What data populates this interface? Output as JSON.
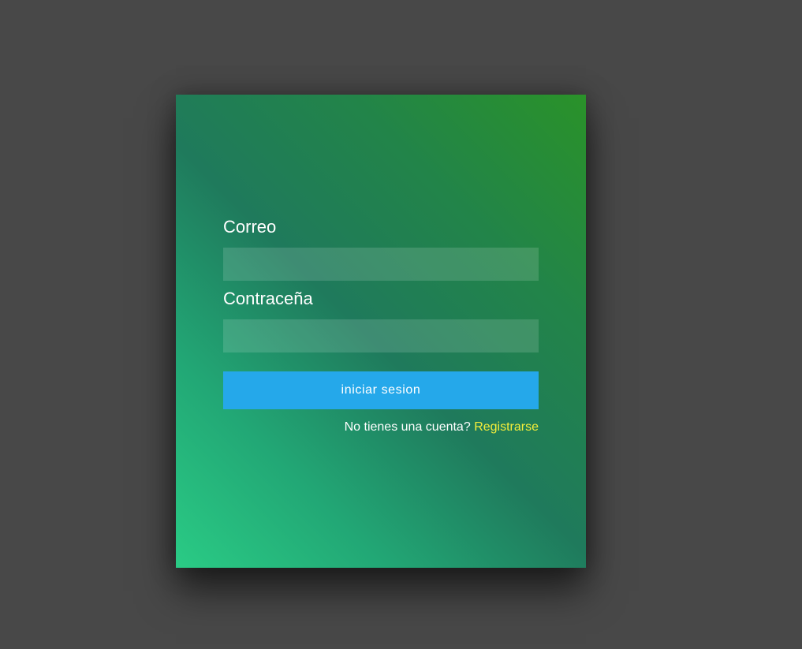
{
  "login_form": {
    "email_label": "Correo",
    "email_value": "",
    "password_label": "Contraceña",
    "password_value": "",
    "submit_label": "iniciar sesion",
    "register_prompt": "No tienes una cuenta?",
    "register_link": "Registrarse"
  },
  "colors": {
    "page_background": "#484848",
    "card_gradient": [
      "#2acb85",
      "#1f7a5c",
      "#2a9229"
    ],
    "button_background": "#25a8ea",
    "link_color": "#f4ee3a"
  }
}
